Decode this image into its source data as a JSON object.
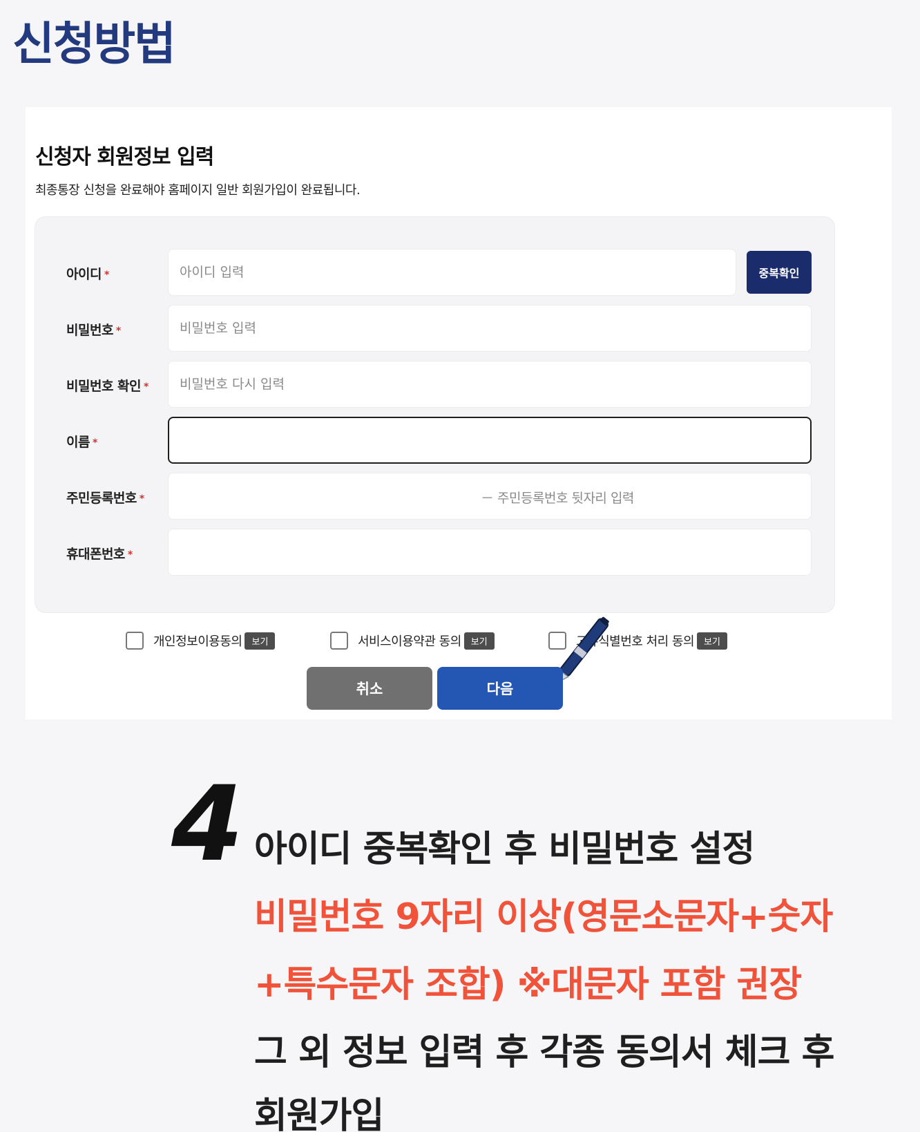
{
  "page_title": "신청방법",
  "form": {
    "title": "신청자 회원정보 입력",
    "subtitle": "최종통장 신청을 완료해야 홈페이지 일반 회원가입이 완료됩니다.",
    "required_mark": "*",
    "fields": [
      {
        "label": "아이디",
        "placeholder": "아이디 입력",
        "value": ""
      },
      {
        "label": "비밀번호",
        "placeholder": "비밀번호 입력",
        "value": ""
      },
      {
        "label": "비밀번호 확인",
        "placeholder": "비밀번호 다시 입력",
        "value": ""
      },
      {
        "label": "이름",
        "placeholder": "",
        "value": ""
      },
      {
        "label": "주민등록번호",
        "placeholder": "",
        "value": "",
        "hint": "－  주민등록번호 뒷자리 입력"
      },
      {
        "label": "휴대폰번호",
        "placeholder": "",
        "value": ""
      }
    ],
    "duplicate_check_button": "중복확인",
    "agreements": [
      {
        "label": "개인정보이용동의",
        "view": "보기"
      },
      {
        "label": "서비스이용약관 동의",
        "view": "보기"
      },
      {
        "label": "고유식별번호 처리 동의",
        "view": "보기"
      }
    ],
    "cancel_button": "취소",
    "next_button": "다음"
  },
  "step": {
    "number": "4",
    "line1": "아이디 중복확인 후 비밀번호 설정",
    "line2": "비밀번호 9자리 이상(영문소문자+숫자",
    "line3": "+특수문자 조합) ※대문자 포함 권장",
    "line4": "그 외 정보 입력 후 각종 동의서 체크 후",
    "line5": "회원가입"
  },
  "colors": {
    "title": "#233a7e",
    "primary_button": "#2357b3",
    "dup_button": "#1a2c6b",
    "cancel_button": "#707070",
    "highlight_text": "#f0533a"
  }
}
